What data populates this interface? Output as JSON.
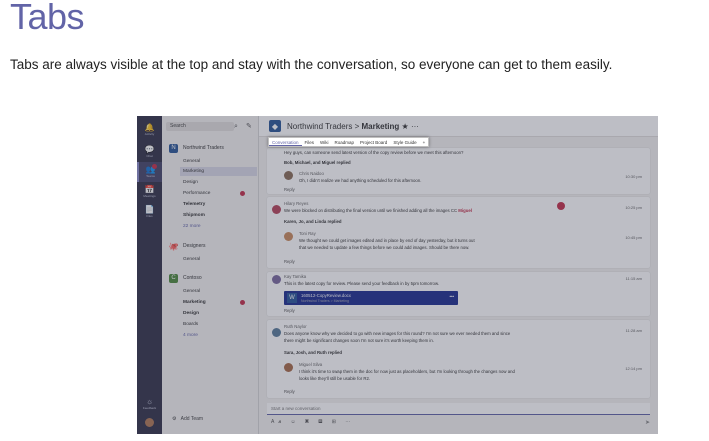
{
  "slide": {
    "title": "Tabs",
    "subtitle": "Tabs are always visible at the top and stay with the conversation, so everyone can get to them easily."
  },
  "rail": [
    {
      "label": "Activity",
      "icon": "bell-icon",
      "glyph": "🔔"
    },
    {
      "label": "Chat",
      "icon": "chat-icon",
      "glyph": "💬"
    },
    {
      "label": "Teams",
      "icon": "teams-icon",
      "glyph": "👥"
    },
    {
      "label": "Meetings",
      "icon": "calendar-icon",
      "glyph": "📅"
    },
    {
      "label": "Files",
      "icon": "file-icon",
      "glyph": "📄"
    }
  ],
  "rail_bottom": {
    "feedback": "Feedback"
  },
  "sidebar": {
    "search_placeholder": "Search",
    "teams": [
      {
        "name": "Northwind Traders",
        "color": "#2b5797",
        "glyph": "N"
      },
      {
        "name": "Designers",
        "color": "#c4314b",
        "glyph": "🐙"
      },
      {
        "name": "Contoso",
        "color": "#4e8a3e",
        "glyph": "C"
      }
    ],
    "channels_nw": [
      "General",
      "Marketing",
      "Design",
      "Performance",
      "Telemetry",
      "Shipmom",
      "22 more"
    ],
    "channels_designers": [
      "General"
    ],
    "channels_contoso": [
      "General",
      "Marketing",
      "Design",
      "Boards",
      "4 more"
    ],
    "add_team": "Add Team"
  },
  "header": {
    "team": "Northwind Traders",
    "separator": ">",
    "channel": "Marketing",
    "star": "★",
    "more": "···"
  },
  "tabs": [
    "Conversation",
    "Files",
    "Wiki",
    "Roadmap",
    "Project Board",
    "Style Guide",
    "+"
  ],
  "posts": [
    {
      "text": "Hey guys, can someone send latest version of the copy review before we meet this afternoon?",
      "replies_label": "Bob, Michael, and Miguel replied",
      "reply_author": "Chris Naidoo",
      "reply_text": "Oh, I didn't realize we had anything scheduled for this afternoon.",
      "time": "10:30 pm",
      "reply": "Reply"
    },
    {
      "author": "Hilary Reyes",
      "text": "We were blocked on distributing the final version until we finished adding all the images CC",
      "mention": "Miguel",
      "time": "10:25 pm",
      "replies_label": "Karen, Jo, and Linda replied",
      "reply_author": "Toni Ray",
      "reply_text_1": "We thought we could get images edited and in place by end of day yesterday, but it turns out",
      "reply_text_2": "that we needed to update a few things before we could add images. Should be there now.",
      "reply_time": "10:45 pm",
      "reply": "Reply"
    },
    {
      "author": "Kay Tamika",
      "text": "This is the latest copy for review. Please send your feedback in by 5pm tomorrow.",
      "time": "11:15 am",
      "doc_name": "160512-CopyReview.docx",
      "doc_meta": "Northwind Traders > Marketing",
      "reply": "Reply"
    },
    {
      "author": "Ruth Naylor",
      "text_1": "Does anyone know why we decided to go with new images for this round? I'm not sure we ever needed them and since",
      "text_2": "there might be significant changes soon I'm not sure it's worth keeping them in.",
      "time": "11:28 am",
      "replies_label": "Sara, Josh, and Ruth replied",
      "reply_author": "Miguel Silva",
      "reply_text_1": "I think it's time to swap them in the doc for now just as placeholders, but I'm looking through the changes now and",
      "reply_text_2": "looks like they'll still be usable for R2.",
      "reply_time": "12:14 pm",
      "reply": "Reply"
    }
  ],
  "compose": {
    "placeholder": "Start a new conversation",
    "tools": "A𝑎 ☺ ▣ ▤ ⊞ ⋯",
    "send": "➤"
  },
  "colors": {
    "accent": "#6264a7",
    "rail": "#33344a",
    "alert": "#c4314b",
    "doc": "#1e2f8f"
  }
}
